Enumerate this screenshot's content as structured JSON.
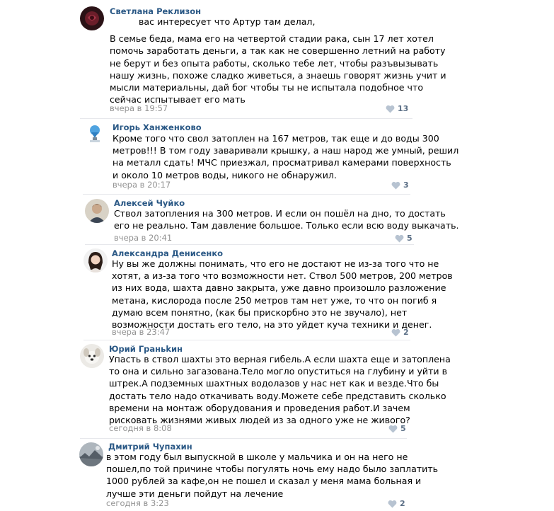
{
  "comments": [
    {
      "author": "Светлана Реклизон",
      "lines": [
        "вас интересует что Артур там делал,",
        "",
        "В семье беда, мама его на четвертой стадии рака, сын 17 лет хотел",
        "помочь заработать деньги, а так как не совершенно летний на работу",
        "не берут и без опыта работы, сколько тебе лет, чтобы разъвызывать",
        "нашу жизнь, похоже сладко живеться, а знаешь говорят жизнь учит и",
        "мысли материальны, дай бог чтобы ты не испытала подобное что",
        "сейчас испытывает его мать"
      ],
      "date": "вчера в 19:57",
      "likes": "13",
      "avatar_icon": "avatar-dark-rose-icon"
    },
    {
      "author": "Игорь Ханженково",
      "lines": [
        "Кроме того что свол затоплен на 167 метров, так еще и до воды 300",
        "метров!!! В том году заваривали крышку, а наш народ же умный, решил",
        "на металл сдать! МЧС приезжал, просматривал камерами поверхность",
        "и около 10 метров воды, никого не обнаружил."
      ],
      "date": "вчера в 20:17",
      "likes": "3",
      "avatar_icon": "avatar-lamp-icon"
    },
    {
      "author": "Алексей Чуйко",
      "lines": [
        "Ствол затопления на 300 метров. И если он пошёл на дно, то достать",
        "его не реально. Там давление большое. Только если всю воду выкачать."
      ],
      "date": "вчера в 20:41",
      "likes": "5",
      "avatar_icon": "avatar-person-icon"
    },
    {
      "author": "Александра Денисенко",
      "lines": [
        "Ну вы же должны понимать, что его не достают не из-за того что не",
        "хотят, а из-за того что возможности нет. Ствол 500 метров, 200 метров",
        "из них вода, шахта давно закрыта, уже давно произошло разложение",
        "метана, кислорода после 250 метров там нет уже, то что он погиб я",
        "думаю всем понятно, (как бы прискорбно это не звучало), нет",
        "возможности достать его тело, на это уйдет куча техники и денег."
      ],
      "date": "вчера в 23:47",
      "likes": "2",
      "avatar_icon": "avatar-woman-icon"
    },
    {
      "author": "Юрий Граньkин",
      "lines": [
        "Упасть в ствол шахты это верная гибель.А если шахта еще и затоплена",
        "то она и сильно загазована.Тело могло опуститься на глубину и уйти в",
        "штрек.А подземных шахтных водолазов у нас нет как и везде.Что бы",
        "достать тело надо откачивать воду.Можете себе представить сколько",
        "времени на монтаж оборудования и проведения работ.И зачем",
        "рисковать жизнями живых людей из за одного уже не живого?"
      ],
      "date": "сегодня в 8:08",
      "likes": "5",
      "avatar_icon": "avatar-dog-icon"
    },
    {
      "author": "Дмитрий Чупахин",
      "lines": [
        "в этом году был выпускной в школе у мальчика и он на него не",
        "пошел,по той причине чтобы погулять ночь ему надо было заплатить",
        "1000 рублей за кафе,он не пошел и сказал у меня мама больная и",
        "лучше эти деньги пойдут на лечение"
      ],
      "date": "сегодня в 3:23",
      "likes": "2",
      "avatar_icon": "avatar-landscape-icon"
    }
  ],
  "colors": {
    "author": "#2a5885",
    "date": "#939393",
    "like_icon": "#b7c3d1",
    "like_count": "#5b6f86",
    "divider": "#e7e8ec"
  }
}
